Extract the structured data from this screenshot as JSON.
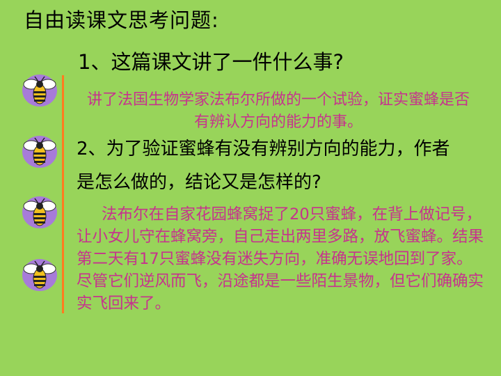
{
  "slide": {
    "title": "自由读课文思考问题:",
    "question1": "1、这篇课文讲了一件什么事?",
    "answer1": "讲了法国生物学家法布尔所做的一个试验，证实蜜蜂是否有辨认方向的能力的事。",
    "question2": "2、为了验证蜜蜂有没有辨别方向的能力，作者是怎么做的，结论又是怎样的?",
    "answer2": "法布尔在自家花园蜂窝捉了20只蜜蜂，在背上做记号，让小女儿守在蜂窝旁，自己走出两里多路，放飞蜜蜂。结果第二天有17只蜜蜂没有迷失方向，准确无误地回到了家。尽管它们逆风而飞，沿途都是一些陌生景物，但它们确确实实飞回来了。"
  },
  "colors": {
    "background": "#98d45a",
    "answer_text": "#c6338d",
    "accent_line": "#ff7b1f",
    "bee_circle": "#a77bd9"
  },
  "icons": [
    "bee-icon",
    "bee-icon",
    "bee-icon",
    "bee-icon"
  ]
}
